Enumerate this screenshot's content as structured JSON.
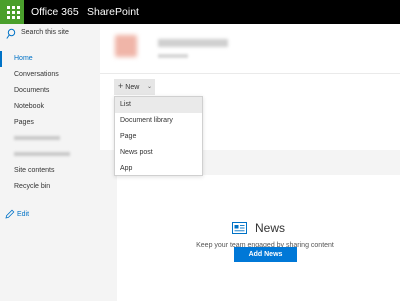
{
  "suitebar": {
    "brand": "Office 365",
    "app_name": "SharePoint"
  },
  "leftnav": {
    "search_placeholder": "Search this site",
    "items": [
      {
        "label": "Home",
        "active": true
      },
      {
        "label": "Conversations"
      },
      {
        "label": "Documents"
      },
      {
        "label": "Notebook"
      },
      {
        "label": "Pages"
      },
      {
        "label": "Site contents"
      },
      {
        "label": "Recycle bin"
      }
    ],
    "edit_label": "Edit"
  },
  "command_bar": {
    "new_label": "New"
  },
  "new_menu": {
    "items": [
      "List",
      "Document library",
      "Page",
      "News post",
      "App"
    ]
  },
  "news": {
    "heading": "News",
    "description": "Keep your team engaged by sharing content and updates",
    "button": "Add News"
  },
  "colors": {
    "accent": "#0072c6",
    "waffle": "#4a9f2c",
    "button": "#0078d7"
  }
}
